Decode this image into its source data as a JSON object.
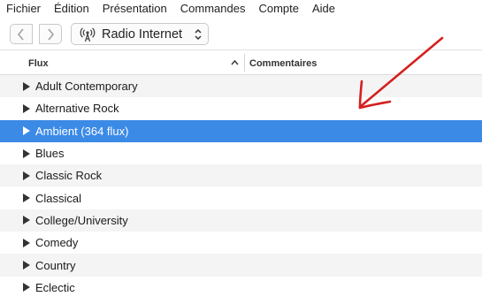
{
  "menu": [
    "Fichier",
    "Édition",
    "Présentation",
    "Commandes",
    "Compte",
    "Aide"
  ],
  "toolbar": {
    "back_icon": "chevron-left-icon",
    "forward_icon": "chevron-right-icon",
    "source_label": "Radio Internet",
    "source_icon": "antenna-icon"
  },
  "table": {
    "columns": [
      "Flux",
      "Commentaires"
    ],
    "sort_icon": "chevron-up-icon",
    "rows": [
      {
        "label": "Adult Contemporary",
        "selected": false
      },
      {
        "label": "Alternative Rock",
        "selected": false
      },
      {
        "label": "Ambient (364 flux)",
        "selected": true
      },
      {
        "label": "Blues",
        "selected": false
      },
      {
        "label": "Classic Rock",
        "selected": false
      },
      {
        "label": "Classical",
        "selected": false
      },
      {
        "label": "College/University",
        "selected": false
      },
      {
        "label": "Comedy",
        "selected": false
      },
      {
        "label": "Country",
        "selected": false
      },
      {
        "label": "Eclectic",
        "selected": false
      }
    ]
  },
  "colors": {
    "selection": "#3b8ae6",
    "annotation_arrow": "#d42020"
  }
}
